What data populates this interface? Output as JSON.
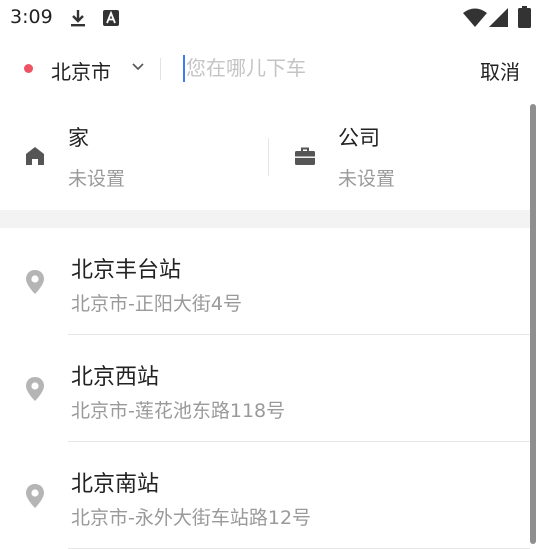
{
  "status_bar": {
    "time": "3:09",
    "left_icons": [
      "download-icon",
      "app-a-icon"
    ],
    "right_icons": [
      "wifi-icon",
      "cell-signal-icon",
      "battery-icon"
    ]
  },
  "search": {
    "city": "北京市",
    "placeholder": "您在哪儿下车",
    "value": "",
    "cancel_label": "取消"
  },
  "shortcuts": {
    "home": {
      "title": "家",
      "subtitle": "未设置",
      "icon": "home-icon"
    },
    "work": {
      "title": "公司",
      "subtitle": "未设置",
      "icon": "briefcase-icon"
    }
  },
  "results": [
    {
      "name": "北京丰台站",
      "address": "北京市-正阳大街4号"
    },
    {
      "name": "北京西站",
      "address": "北京市-莲花池东路118号"
    },
    {
      "name": "北京南站",
      "address": "北京市-永外大街车站路12号"
    }
  ],
  "colors": {
    "accent_dot": "#ef5363",
    "caret": "#3d7cf1",
    "secondary_text": "#9a9a9a",
    "icon": "#555555"
  }
}
